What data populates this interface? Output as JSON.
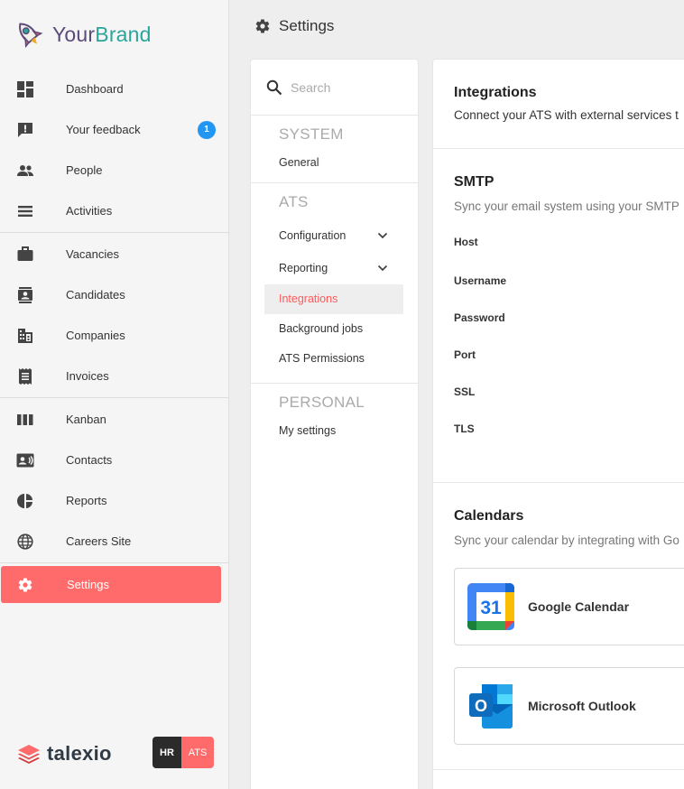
{
  "brand": {
    "your": "Your",
    "brand": "Brand"
  },
  "nav": {
    "dashboard": "Dashboard",
    "feedback": "Your feedback",
    "feedback_badge": "1",
    "people": "People",
    "activities": "Activities",
    "vacancies": "Vacancies",
    "candidates": "Candidates",
    "companies": "Companies",
    "invoices": "Invoices",
    "kanban": "Kanban",
    "contacts": "Contacts",
    "reports": "Reports",
    "careers": "Careers Site",
    "settings": "Settings"
  },
  "footer": {
    "logo": "talexio",
    "hr": "HR",
    "ats": "ATS"
  },
  "header": {
    "title": "Settings"
  },
  "menu": {
    "search_placeholder": "Search",
    "system_title": "SYSTEM",
    "general": "General",
    "ats_title": "ATS",
    "configuration": "Configuration",
    "reporting": "Reporting",
    "integrations": "Integrations",
    "background_jobs": "Background jobs",
    "ats_permissions": "ATS Permissions",
    "personal_title": "PERSONAL",
    "my_settings": "My settings"
  },
  "content": {
    "integrations_title": "Integrations",
    "integrations_desc": "Connect your ATS with external services t",
    "smtp_title": "SMTP",
    "smtp_desc": "Sync your email system using your SMTP",
    "fields": [
      "Host",
      "Username",
      "Password",
      "Port",
      "SSL",
      "TLS"
    ],
    "calendars_title": "Calendars",
    "calendars_desc": "Sync your calendar by integrating with Go",
    "google": "Google Calendar",
    "google_day": "31",
    "outlook": "Microsoft Outlook",
    "outlook_letter": "O"
  },
  "colors": {
    "accent": "#ff6b6b",
    "badge": "#2196f3",
    "brand_teal": "#2aa59b",
    "brand_purple": "#5b4b7a"
  }
}
